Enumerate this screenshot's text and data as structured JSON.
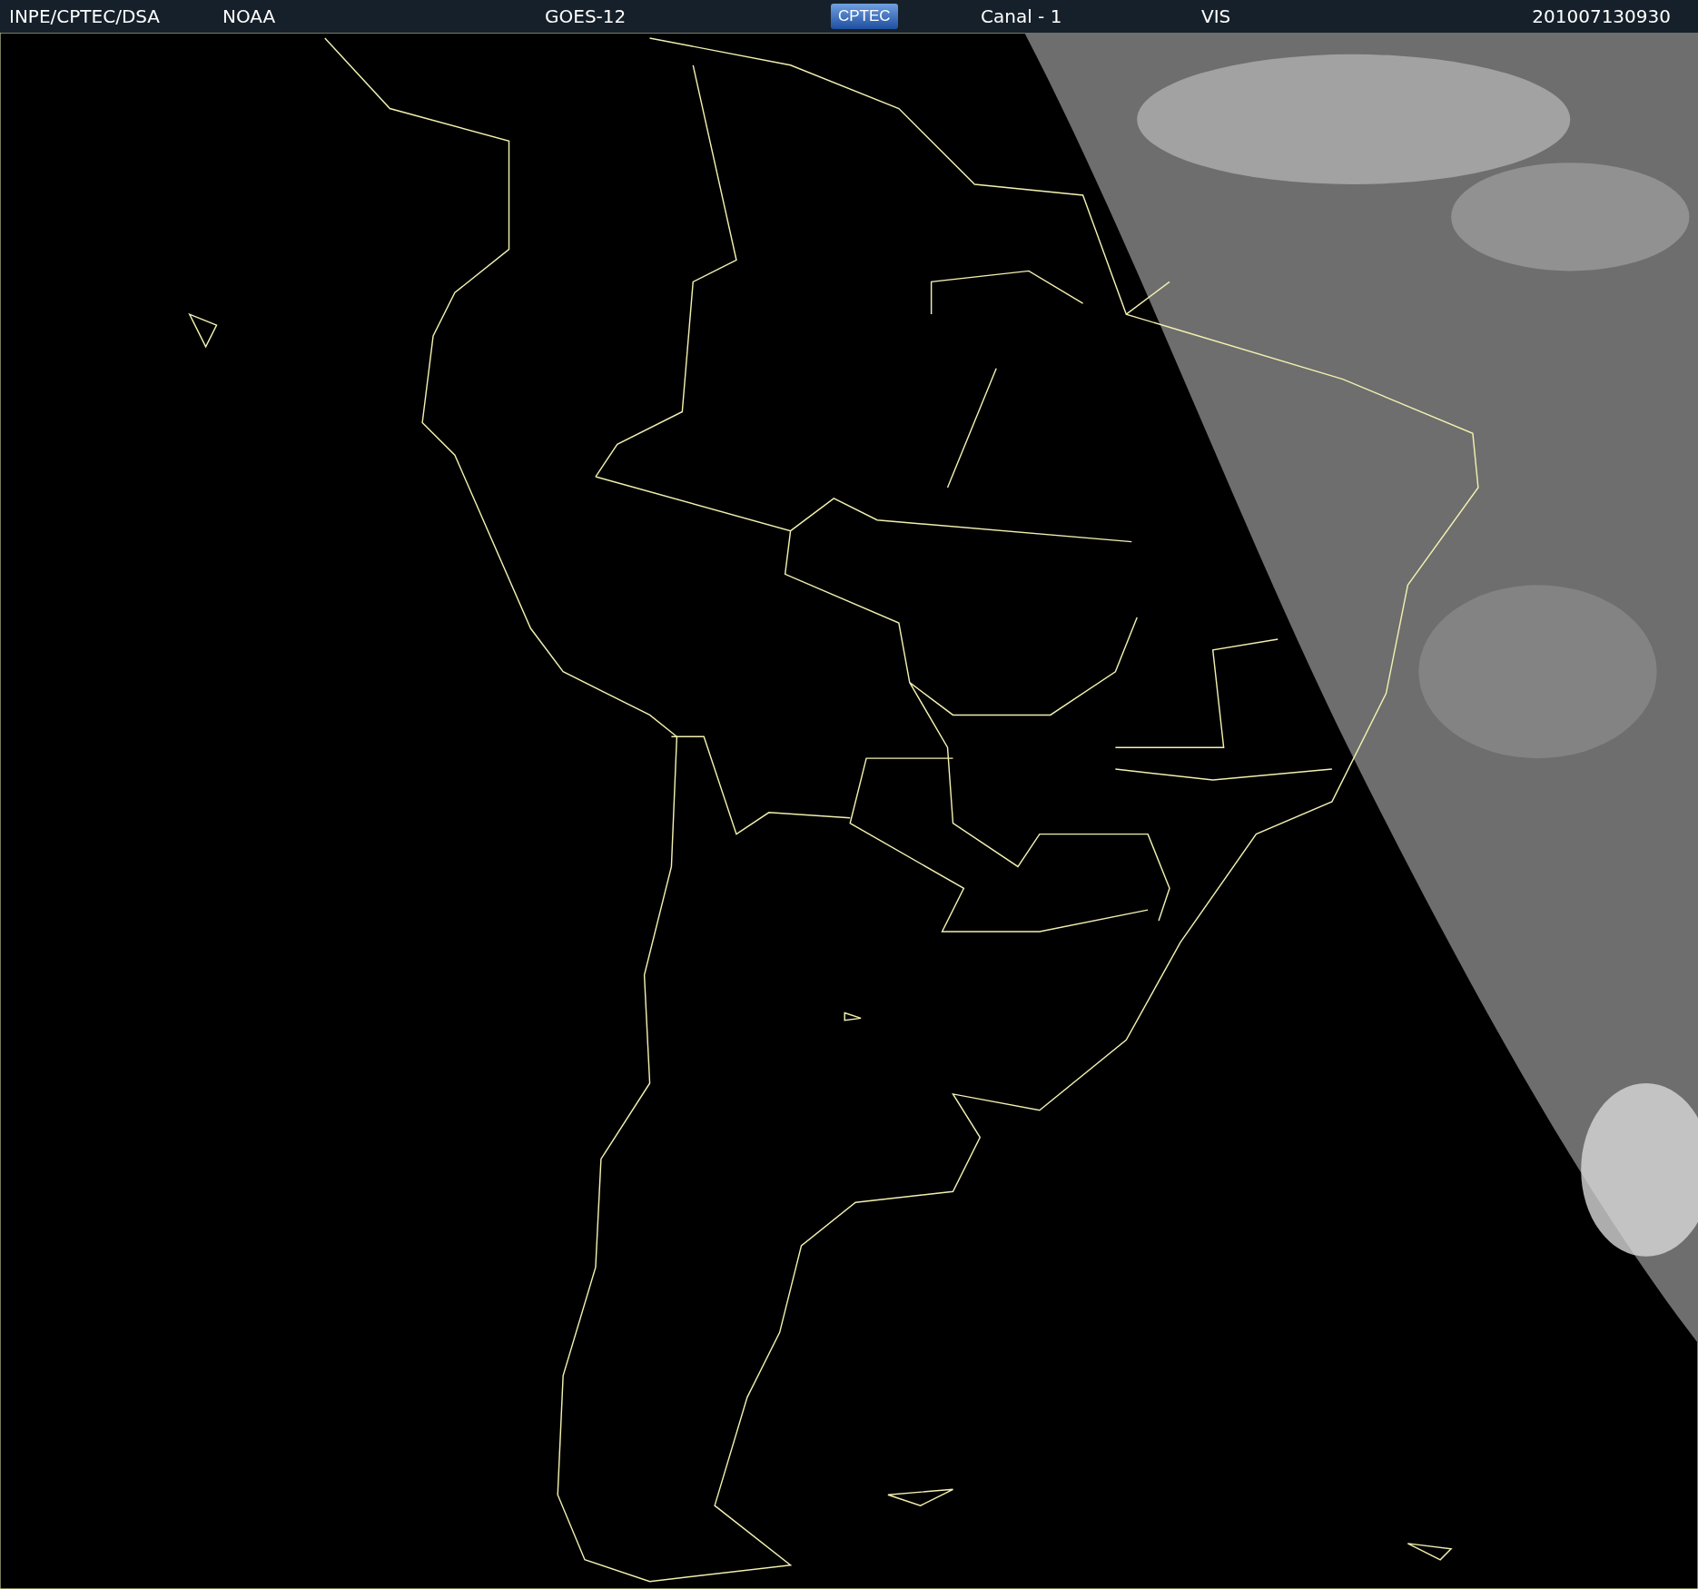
{
  "header": [
    {
      "kind": "text",
      "text": "INPE/CPTEC/DSA"
    },
    {
      "kind": "text",
      "text": "NOAA"
    },
    {
      "kind": "text",
      "text": "GOES-12"
    },
    {
      "kind": "logo",
      "text": "CPTEC"
    },
    {
      "kind": "text",
      "text": "Canal - 1"
    },
    {
      "kind": "text",
      "text": "VIS"
    },
    {
      "kind": "time",
      "text": "201007130930"
    }
  ]
}
